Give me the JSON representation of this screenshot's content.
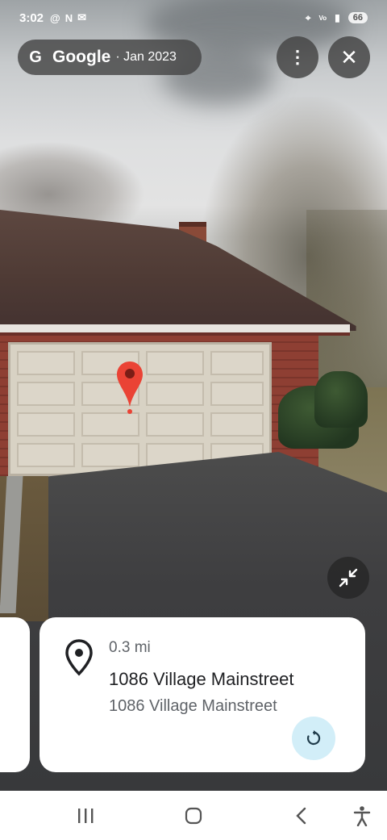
{
  "status_bar": {
    "time": "3:02",
    "notification_icons": [
      "threads-icon",
      "nfc-icon",
      "mail-icon"
    ],
    "right_icons": [
      "location-icon",
      "vowifi-icon",
      "signal-icon"
    ],
    "battery": "66"
  },
  "top_overlay": {
    "logo_glyph": "G",
    "brand": "Google",
    "date": "· Jan 2023"
  },
  "place_card": {
    "distance": "0.3 mi",
    "title": "1086 Village Mainstreet",
    "address": "1086 Village Mainstreet"
  },
  "colors": {
    "marker": "#ea4335",
    "refresh_bg": "#d2eef8",
    "pill_bg": "#464646"
  },
  "nav_bar": {
    "icons": [
      "recents-icon",
      "home-icon",
      "back-icon",
      "accessibility-icon"
    ]
  }
}
